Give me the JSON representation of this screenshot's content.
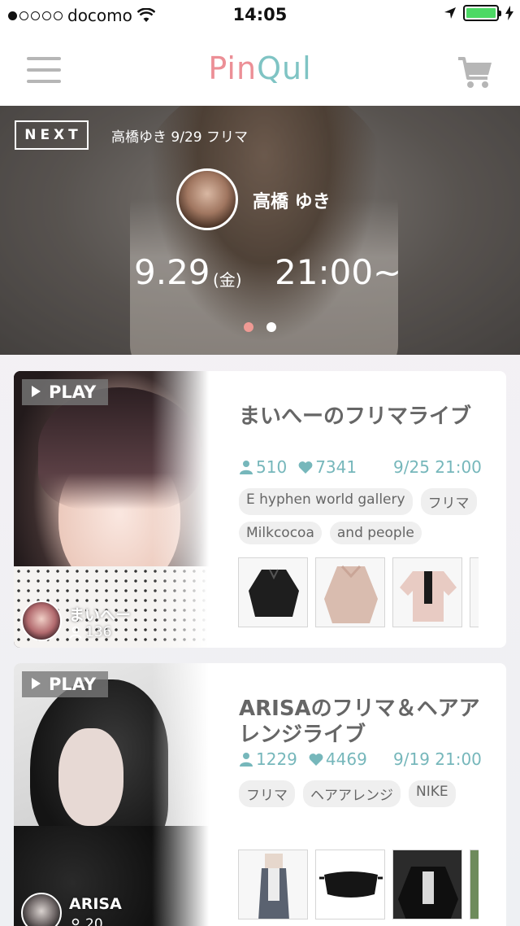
{
  "status_bar": {
    "carrier": "docomo",
    "time": "14:05"
  },
  "header": {
    "logo_part1": "Pin",
    "logo_part2": "Qul"
  },
  "hero": {
    "next_label": "NEXT",
    "subtitle": "高橋ゆき 9/29 フリマ",
    "host_name": "高橋 ゆき",
    "date": "9.29",
    "weekday": "(金)",
    "time": "21:00~",
    "pages": 2,
    "active_page": 1
  },
  "lives": [
    {
      "play_label": "PLAY",
      "title": "まいへーのフリマライブ",
      "viewers": "510",
      "likes": "7341",
      "datetime": "9/25 21:00",
      "tags": [
        "E hyphen world gallery",
        "フリマ",
        "Milkcocoa",
        "and people"
      ],
      "owner_name": "まいへー",
      "owner_followers": "136"
    },
    {
      "play_label": "PLAY",
      "title": "ARISAのフリマ＆ヘアアレンジライブ",
      "viewers": "1229",
      "likes": "4469",
      "datetime": "9/19 21:00",
      "tags": [
        "フリマ",
        "ヘアアレンジ",
        "NIKE"
      ],
      "owner_name": "ARISA",
      "owner_followers": "20"
    }
  ],
  "colors": {
    "accent_pink": "#ec8f96",
    "accent_teal": "#76b7bb",
    "battery_green": "#4cd964"
  }
}
